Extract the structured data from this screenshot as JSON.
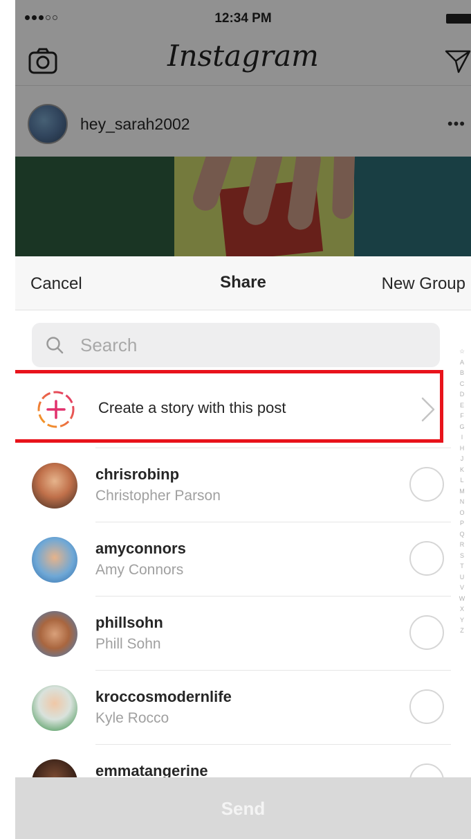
{
  "status_bar": {
    "time": "12:34 PM"
  },
  "feed": {
    "app_name": "Instagram",
    "post_username": "hey_sarah2002",
    "post_more": "•••"
  },
  "share_sheet": {
    "cancel_label": "Cancel",
    "title": "Share",
    "new_group_label": "New Group",
    "search_placeholder": "Search",
    "story_label": "Create a story with this post",
    "alphabet": [
      "☆",
      "A",
      "B",
      "C",
      "D",
      "E",
      "F",
      "G",
      "I",
      "H",
      "J",
      "K",
      "L",
      "M",
      "N",
      "O",
      "P",
      "Q",
      "R",
      "S",
      "T",
      "U",
      "V",
      "W",
      "X",
      "Y",
      "Z"
    ],
    "users": [
      {
        "handle": "chrisrobinp",
        "full_name": "Christopher Parson"
      },
      {
        "handle": "amyconnors",
        "full_name": "Amy Connors"
      },
      {
        "handle": "phillsohn",
        "full_name": "Phill Sohn"
      },
      {
        "handle": "kroccosmodernlife",
        "full_name": "Kyle Rocco"
      },
      {
        "handle": "emmatangerine",
        "full_name": ""
      }
    ],
    "send_label": "Send"
  },
  "colors": {
    "highlight": "#e8131b",
    "story_gradient_start": "#f4a31e",
    "story_gradient_end": "#e1306c"
  }
}
